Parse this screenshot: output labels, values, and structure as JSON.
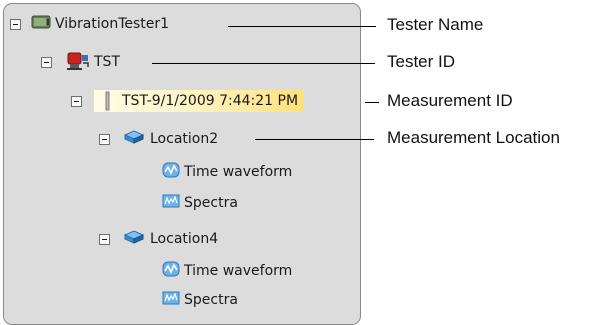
{
  "tree": {
    "tester_name": "VibrationTester1",
    "tester_id": "TST",
    "measurement": "TST-9/1/2009 7:44:21 PM",
    "locations": [
      {
        "label": "Location2",
        "children": [
          "Time waveform",
          "Spectra"
        ]
      },
      {
        "label": "Location4",
        "children": [
          "Time waveform",
          "Spectra"
        ]
      }
    ]
  },
  "callouts": {
    "tester_name": "Tester Name",
    "tester_id": "Tester ID",
    "measurement_id": "Measurement ID",
    "measurement_location": "Measurement Location"
  },
  "icons": {
    "tester": "monitor-icon",
    "device": "tester-device-icon",
    "measurement": "measurement-marker-icon",
    "location": "location-cube-icon",
    "waveform": "waveform-icon",
    "spectra": "spectra-icon"
  },
  "colors": {
    "panel_bg": "#dcdcdc",
    "selection_start": "#fffbe6",
    "selection_end": "#ffe07a"
  }
}
